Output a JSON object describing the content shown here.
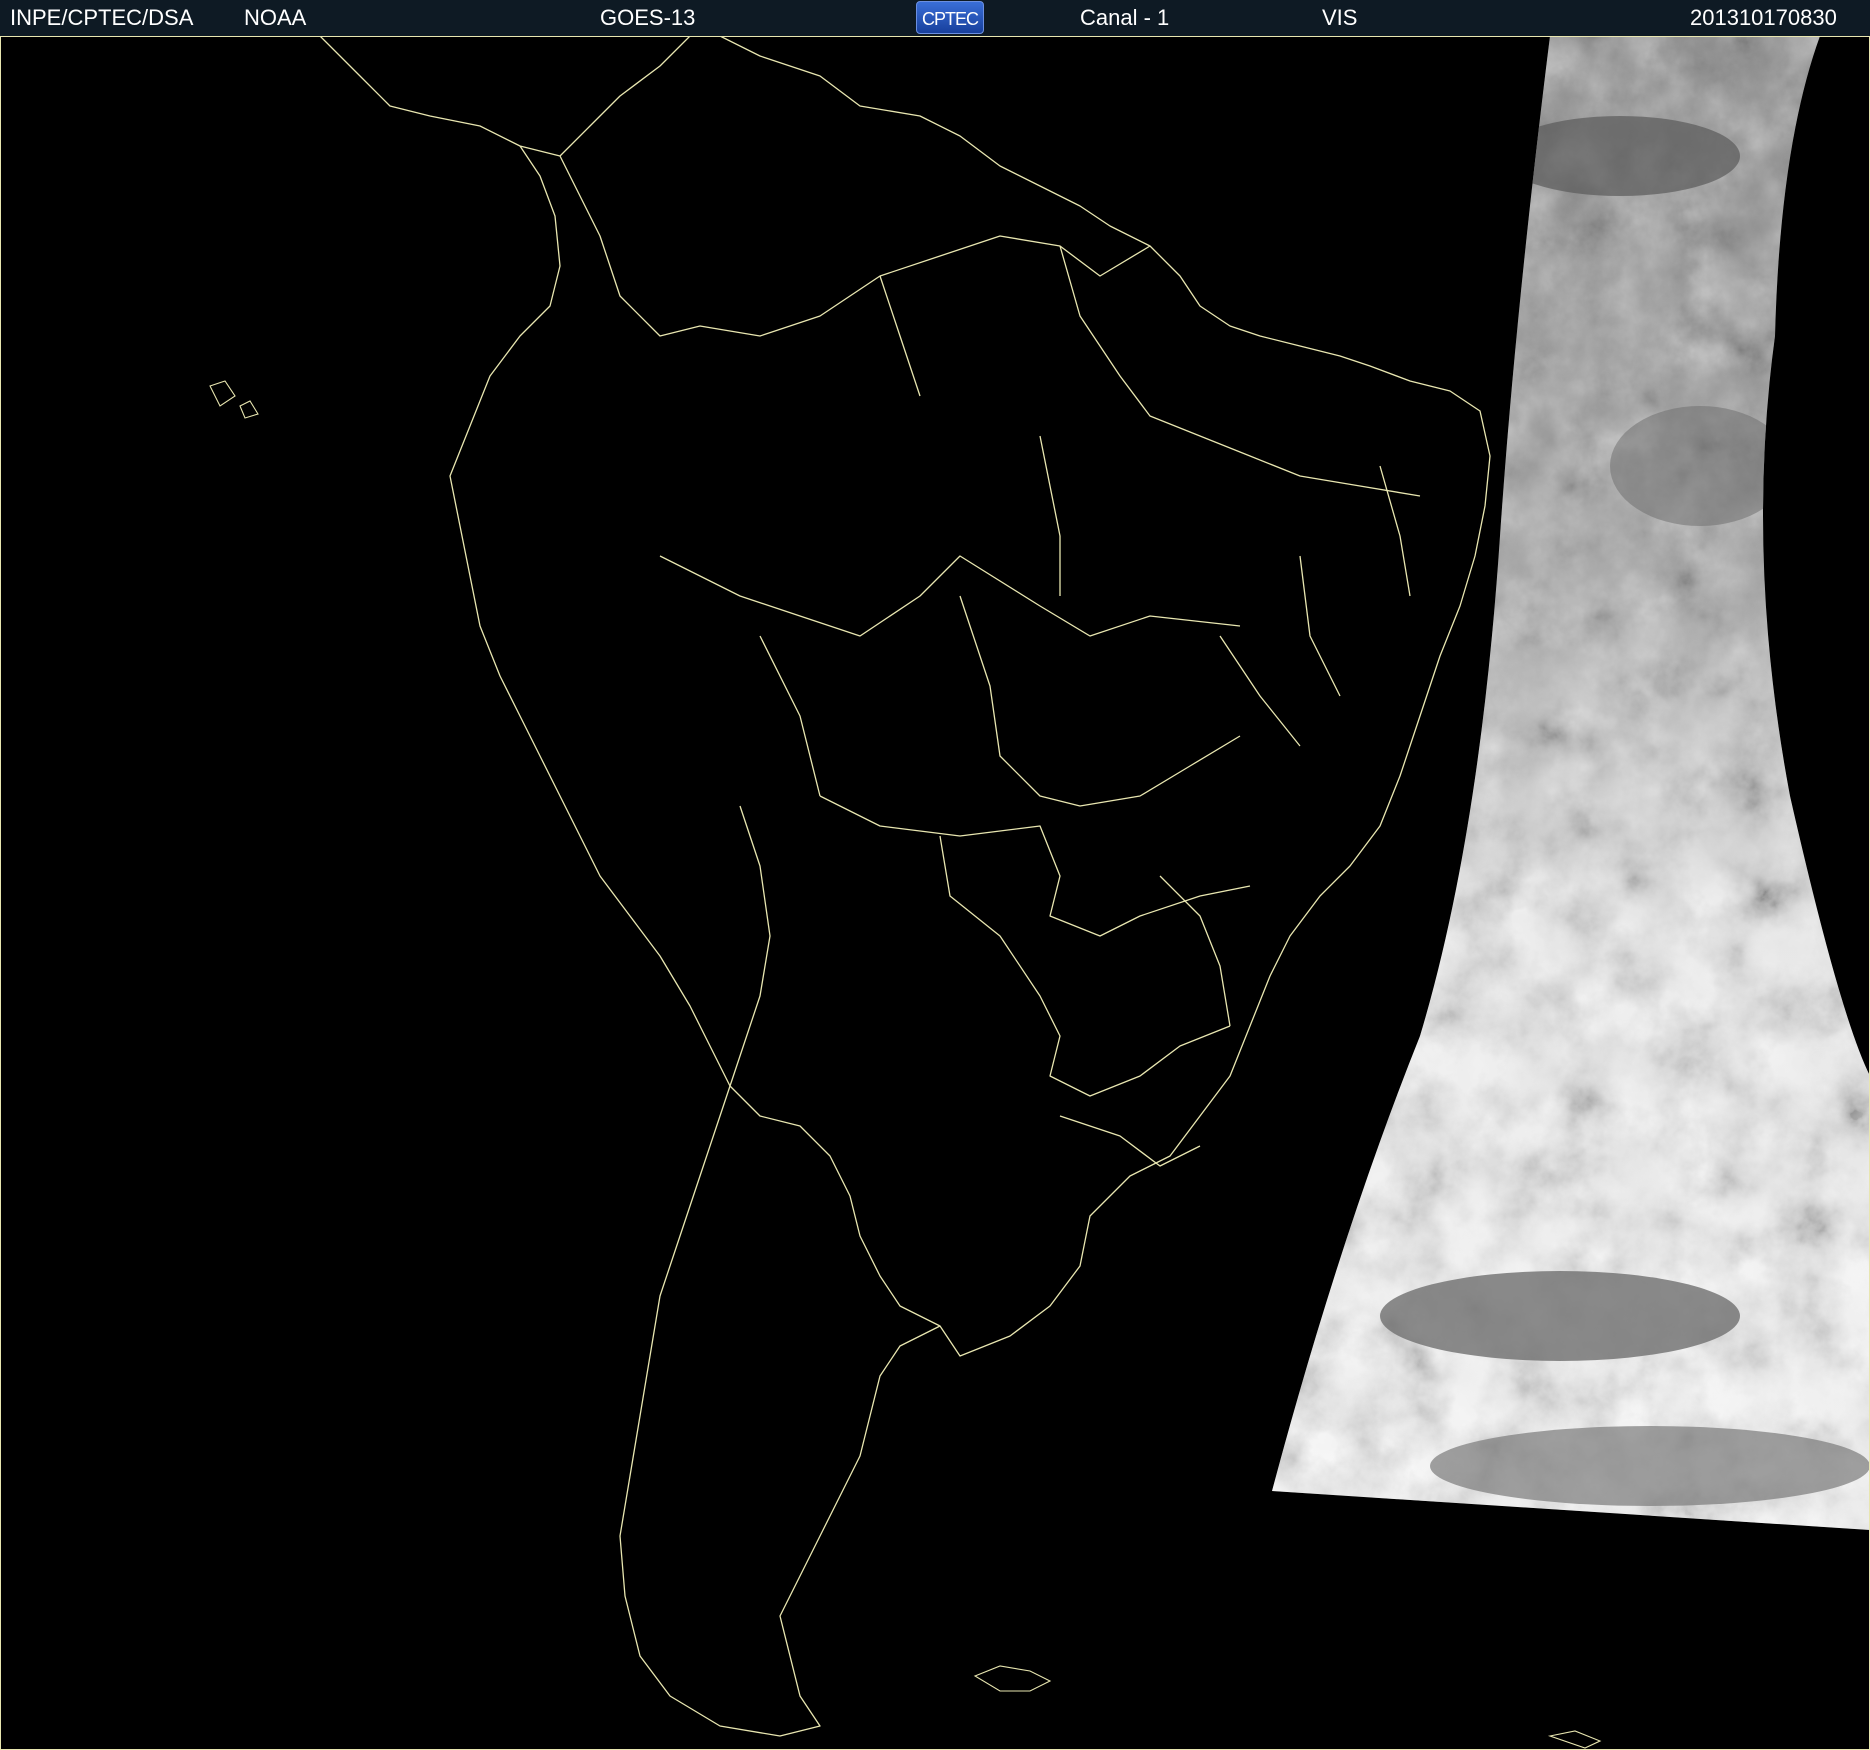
{
  "header": {
    "institution": "INPE/CPTEC/DSA",
    "agency": "NOAA",
    "satellite": "GOES-13",
    "logo_text": "CPTEC",
    "channel": "Canal - 1",
    "band": "VIS",
    "timestamp": "201310170830"
  },
  "colors": {
    "background": "#000000",
    "header_background": "#0e1a24",
    "header_text": "#ffffff",
    "border_lines": "#e8e6b0",
    "cloud_light": "#e6e6e6",
    "cloud_dark": "#6a6a6a",
    "logo_blue": "#2a5bc4"
  },
  "map": {
    "region": "South America",
    "image_type": "visible-satellite-imagery",
    "illuminated_region": "eastern-edge-day-terminator"
  }
}
